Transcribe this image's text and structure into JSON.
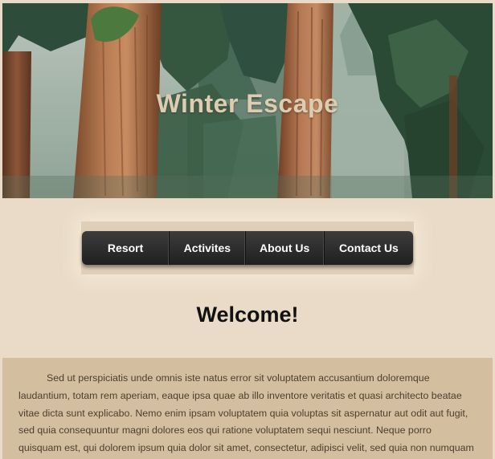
{
  "hero": {
    "title": "Winter Escape",
    "image": "forest-redwood-trees"
  },
  "nav": {
    "items": [
      {
        "label": "Resort"
      },
      {
        "label": "Activites"
      },
      {
        "label": "About Us"
      },
      {
        "label": "Contact Us"
      }
    ]
  },
  "main": {
    "heading": "Welcome!",
    "paragraph": "Sed ut perspiciatis unde omnis iste natus error sit voluptatem accusantium doloremque laudantium, totam rem aperiam, eaque ipsa quae ab illo inventore veritatis et quasi architecto beatae vitae dicta sunt explicabo. Nemo enim ipsam voluptatem quia voluptas sit aspernatur aut odit aut fugit, sed quia consequuntur magni dolores eos qui ratione voluptatem sequi nesciunt. Neque porro quisquam est, qui dolorem ipsum quia dolor sit amet, consectetur, adipisci velit, sed quia non numquam"
  },
  "colors": {
    "page_background": "#e9dbc7",
    "content_background": "#d3bfa0",
    "nav_background": "#2a2a2a",
    "nav_text": "#ffffff",
    "title_text": "#dcccb2",
    "body_text": "#4d3e2e"
  }
}
